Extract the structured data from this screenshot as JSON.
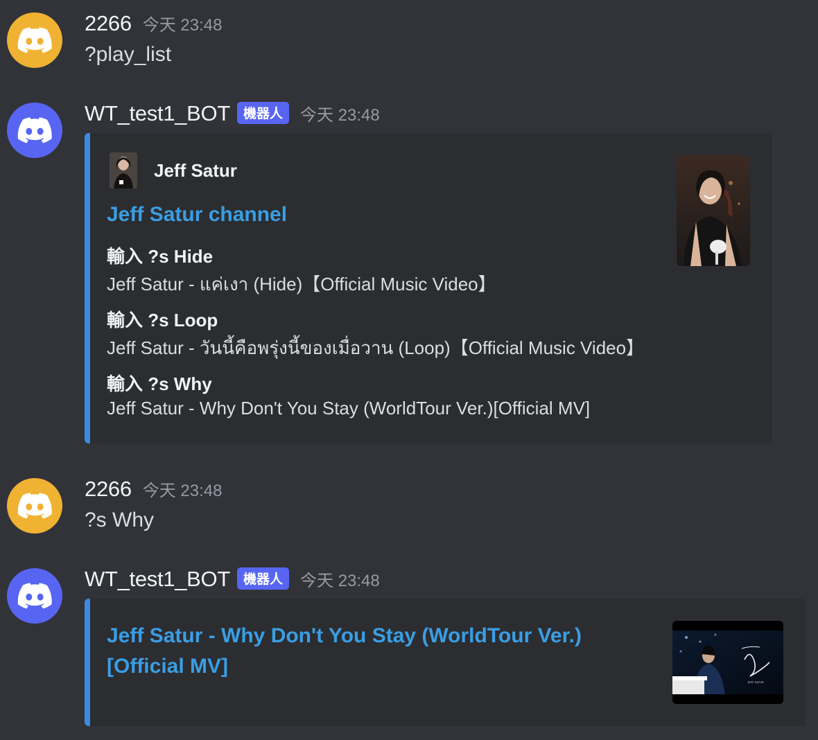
{
  "messages": [
    {
      "username": "2266",
      "timestamp": "今天 23:48",
      "content": "?play_list"
    },
    {
      "username": "WT_test1_BOT",
      "bot_tag": "機器人",
      "timestamp": "今天 23:48",
      "embed": {
        "author_name": "Jeff Satur",
        "title": "Jeff Satur channel",
        "fields": [
          {
            "name": "輸入 ?s Hide",
            "value": "Jeff Satur - แค่เงา (Hide)【Official Music Video】"
          },
          {
            "name": "輸入 ?s Loop",
            "value": "Jeff Satur - วันนี้คือพรุ่งนี้ของเมื่อวาน (Loop)【Official Music Video】"
          },
          {
            "name": "輸入 ?s Why",
            "value": "Jeff Satur - Why Don't You Stay (WorldTour Ver.)[Official MV]"
          }
        ]
      }
    },
    {
      "username": "2266",
      "timestamp": "今天 23:48",
      "content": "?s Why"
    },
    {
      "username": "WT_test1_BOT",
      "bot_tag": "機器人",
      "timestamp": "今天 23:48",
      "embed": {
        "title_line1": "Jeff Satur - Why Don't You Stay (WorldTour Ver.)",
        "title_line2": "[Official MV]"
      }
    }
  ],
  "colors": {
    "background": "#313338",
    "embed_background": "#2b2d31",
    "embed_border": "#3a8be0",
    "link": "#3a9ee4",
    "avatar_user": "#f0b232",
    "avatar_bot": "#5865f2",
    "bot_tag": "#5865f2"
  },
  "icons": {
    "avatar": "discord-logo-icon"
  }
}
